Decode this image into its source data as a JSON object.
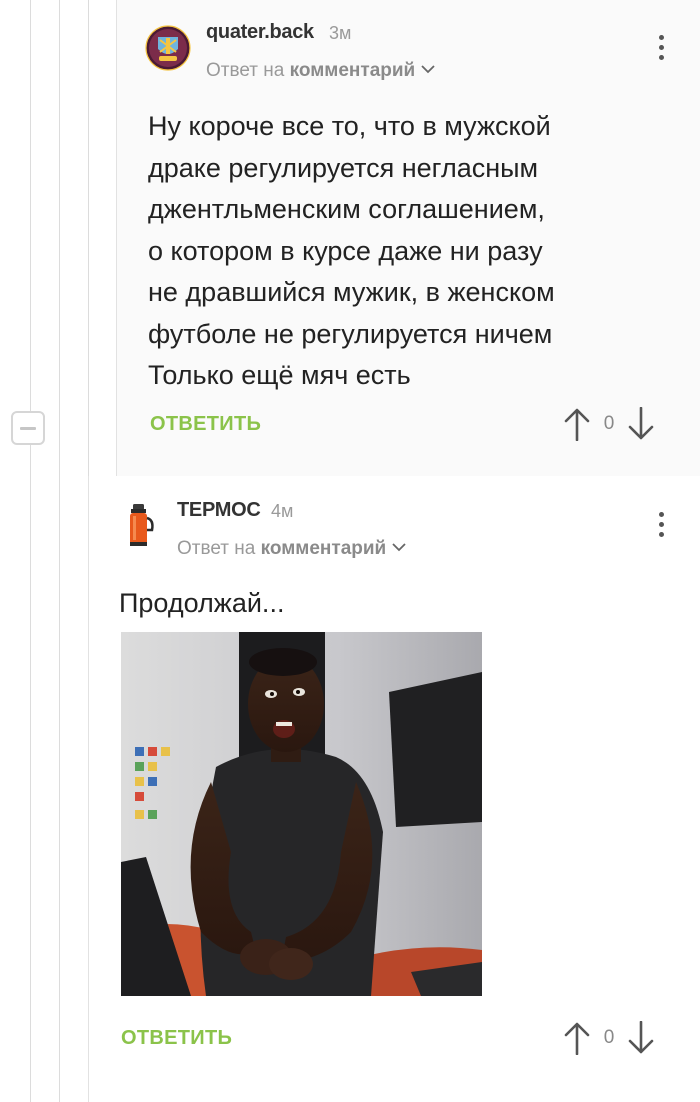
{
  "thread": {
    "comments": [
      {
        "username": "quater.back",
        "time": "3м",
        "reply_prefix": "Ответ на",
        "reply_target": "комментарий",
        "body": "Ну короче все то, что в мужской\nдраке регулируется негласным\nджентльменским соглашением,\nо котором в курсе даже ни разу\nне дравшийся мужик, в женском\nфутболе не регулируется ничем\nТолько ещё мяч есть",
        "reply_label": "ОТВЕТИТЬ",
        "rating": "0",
        "avatar_icon": "club-crest-icon"
      },
      {
        "username": "ТЕРМОС",
        "time": "4м",
        "reply_prefix": "Ответ на",
        "reply_target": "комментарий",
        "body": "Продолжай...",
        "reply_label": "ОТВЕТИТЬ",
        "rating": "0",
        "avatar_icon": "thermos-icon",
        "image": "gif-man-gesturing"
      }
    ]
  },
  "colors": {
    "reply_green": "#8bc34a",
    "thread_line": "#dcdcdc",
    "text": "#222222",
    "muted": "#999999"
  }
}
